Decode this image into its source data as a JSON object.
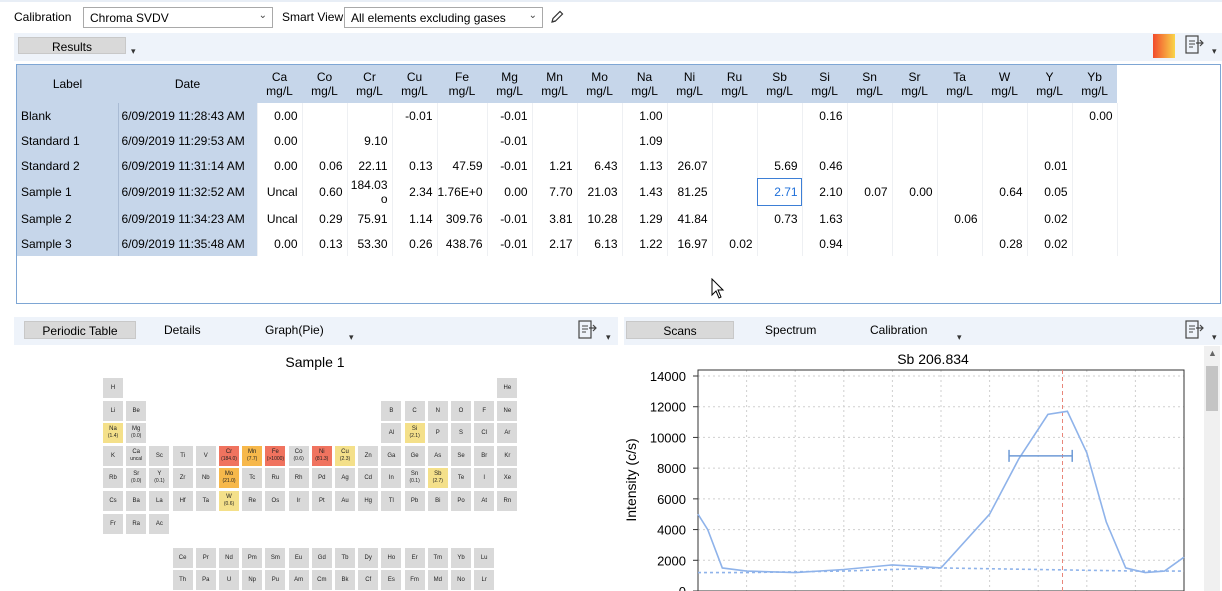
{
  "toolbar": {
    "calibration_label": "Calibration",
    "calibration_value": "Chroma SVDV",
    "smartview_label": "Smart View",
    "smartview_value": "All elements excluding gases"
  },
  "results_tab": "Results",
  "columns": {
    "label": "Label",
    "date": "Date",
    "elements": [
      {
        "el": "Ca",
        "unit": "mg/L"
      },
      {
        "el": "Co",
        "unit": "mg/L"
      },
      {
        "el": "Cr",
        "unit": "mg/L"
      },
      {
        "el": "Cu",
        "unit": "mg/L"
      },
      {
        "el": "Fe",
        "unit": "mg/L"
      },
      {
        "el": "Mg",
        "unit": "mg/L"
      },
      {
        "el": "Mn",
        "unit": "mg/L"
      },
      {
        "el": "Mo",
        "unit": "mg/L"
      },
      {
        "el": "Na",
        "unit": "mg/L"
      },
      {
        "el": "Ni",
        "unit": "mg/L"
      },
      {
        "el": "Ru",
        "unit": "mg/L"
      },
      {
        "el": "Sb",
        "unit": "mg/L"
      },
      {
        "el": "Si",
        "unit": "mg/L"
      },
      {
        "el": "Sn",
        "unit": "mg/L"
      },
      {
        "el": "Sr",
        "unit": "mg/L"
      },
      {
        "el": "Ta",
        "unit": "mg/L"
      },
      {
        "el": "W",
        "unit": "mg/L"
      },
      {
        "el": "Y",
        "unit": "mg/L"
      },
      {
        "el": "Yb",
        "unit": "mg/L"
      }
    ]
  },
  "rows": [
    {
      "label": "Blank",
      "date": "6/09/2019 11:28:43 AM",
      "values": [
        "0.00",
        "",
        "",
        "-0.01",
        "",
        "-0.01",
        "",
        "",
        "1.00",
        "",
        "",
        "",
        "0.16",
        "",
        "",
        "",
        "",
        "",
        "0.00"
      ]
    },
    {
      "label": "Standard 1",
      "date": "6/09/2019 11:29:53 AM",
      "values": [
        "0.00",
        "",
        "9.10",
        "",
        "",
        "-0.01",
        "",
        "",
        "1.09",
        "",
        "",
        "",
        "",
        "",
        "",
        "",
        "",
        "",
        ""
      ]
    },
    {
      "label": "Standard 2",
      "date": "6/09/2019 11:31:14 AM",
      "values": [
        "0.00",
        "0.06",
        "22.11",
        "0.13",
        "47.59",
        "-0.01",
        "1.21",
        "6.43",
        "1.13",
        "26.07",
        "",
        "5.69",
        "0.46",
        "",
        "",
        "",
        "",
        "0.01",
        ""
      ]
    },
    {
      "label": "Sample 1",
      "date": "6/09/2019 11:32:52 AM",
      "values": [
        "Uncal",
        "0.60",
        "184.03 o",
        "2.34",
        "1.76E+0",
        "0.00",
        "7.70",
        "21.03",
        "1.43",
        "81.25",
        "",
        "2.71",
        "2.10",
        "0.07",
        "0.00",
        "",
        "0.64",
        "0.05",
        ""
      ]
    },
    {
      "label": "Sample 2",
      "date": "6/09/2019 11:34:23 AM",
      "values": [
        "Uncal",
        "0.29",
        "75.91",
        "1.14",
        "309.76",
        "-0.01",
        "3.81",
        "10.28",
        "1.29",
        "41.84",
        "",
        "0.73",
        "1.63",
        "",
        "",
        "0.06",
        "",
        "0.02",
        ""
      ]
    },
    {
      "label": "Sample 3",
      "date": "6/09/2019 11:35:48 AM",
      "values": [
        "0.00",
        "0.13",
        "53.30",
        "0.26",
        "438.76",
        "-0.01",
        "2.17",
        "6.13",
        "1.22",
        "16.97",
        "0.02",
        "",
        "0.94",
        "",
        "",
        "",
        "0.28",
        "0.02",
        ""
      ]
    }
  ],
  "selected_cell": {
    "row": 3,
    "col": 11
  },
  "left_tabs": [
    "Periodic Table",
    "Details",
    "Graph(Pie)"
  ],
  "right_tabs": [
    "Scans",
    "Spectrum",
    "Calibration"
  ],
  "periodic_title": "Sample 1",
  "periodic_cells": [
    {
      "sym": "H",
      "r": 0,
      "c": 0
    },
    {
      "sym": "He",
      "r": 0,
      "c": 17
    },
    {
      "sym": "Li",
      "r": 1,
      "c": 0
    },
    {
      "sym": "Be",
      "r": 1,
      "c": 1
    },
    {
      "sym": "B",
      "r": 1,
      "c": 12
    },
    {
      "sym": "C",
      "r": 1,
      "c": 13
    },
    {
      "sym": "N",
      "r": 1,
      "c": 14
    },
    {
      "sym": "O",
      "r": 1,
      "c": 15
    },
    {
      "sym": "F",
      "r": 1,
      "c": 16
    },
    {
      "sym": "Ne",
      "r": 1,
      "c": 17
    },
    {
      "sym": "Na",
      "r": 2,
      "c": 0,
      "val": "(1.4)",
      "color": "#f4e08a"
    },
    {
      "sym": "Mg",
      "r": 2,
      "c": 1,
      "val": "(0.0)"
    },
    {
      "sym": "Al",
      "r": 2,
      "c": 12
    },
    {
      "sym": "Si",
      "r": 2,
      "c": 13,
      "val": "(2.1)",
      "color": "#f4e08a"
    },
    {
      "sym": "P",
      "r": 2,
      "c": 14
    },
    {
      "sym": "S",
      "r": 2,
      "c": 15
    },
    {
      "sym": "Cl",
      "r": 2,
      "c": 16
    },
    {
      "sym": "Ar",
      "r": 2,
      "c": 17
    },
    {
      "sym": "K",
      "r": 3,
      "c": 0
    },
    {
      "sym": "Ca",
      "r": 3,
      "c": 1,
      "val": "uncal"
    },
    {
      "sym": "Sc",
      "r": 3,
      "c": 2
    },
    {
      "sym": "Ti",
      "r": 3,
      "c": 3
    },
    {
      "sym": "V",
      "r": 3,
      "c": 4
    },
    {
      "sym": "Cr",
      "r": 3,
      "c": 5,
      "val": "(184.0)",
      "color": "#f0735f"
    },
    {
      "sym": "Mn",
      "r": 3,
      "c": 6,
      "val": "(7.7)",
      "color": "#f7b84b"
    },
    {
      "sym": "Fe",
      "r": 3,
      "c": 7,
      "val": "(>1000)",
      "color": "#f0735f"
    },
    {
      "sym": "Co",
      "r": 3,
      "c": 8,
      "val": "(0.6)"
    },
    {
      "sym": "Ni",
      "r": 3,
      "c": 9,
      "val": "(81.3)",
      "color": "#f0735f"
    },
    {
      "sym": "Cu",
      "r": 3,
      "c": 10,
      "val": "(2.3)",
      "color": "#f4e08a"
    },
    {
      "sym": "Zn",
      "r": 3,
      "c": 11
    },
    {
      "sym": "Ga",
      "r": 3,
      "c": 12
    },
    {
      "sym": "Ge",
      "r": 3,
      "c": 13
    },
    {
      "sym": "As",
      "r": 3,
      "c": 14
    },
    {
      "sym": "Se",
      "r": 3,
      "c": 15
    },
    {
      "sym": "Br",
      "r": 3,
      "c": 16
    },
    {
      "sym": "Kr",
      "r": 3,
      "c": 17
    },
    {
      "sym": "Rb",
      "r": 4,
      "c": 0
    },
    {
      "sym": "Sr",
      "r": 4,
      "c": 1,
      "val": "(0.0)"
    },
    {
      "sym": "Y",
      "r": 4,
      "c": 2,
      "val": "(0.1)"
    },
    {
      "sym": "Zr",
      "r": 4,
      "c": 3
    },
    {
      "sym": "Nb",
      "r": 4,
      "c": 4
    },
    {
      "sym": "Mo",
      "r": 4,
      "c": 5,
      "val": "(21.0)",
      "color": "#f7b84b"
    },
    {
      "sym": "Tc",
      "r": 4,
      "c": 6
    },
    {
      "sym": "Ru",
      "r": 4,
      "c": 7
    },
    {
      "sym": "Rh",
      "r": 4,
      "c": 8
    },
    {
      "sym": "Pd",
      "r": 4,
      "c": 9
    },
    {
      "sym": "Ag",
      "r": 4,
      "c": 10
    },
    {
      "sym": "Cd",
      "r": 4,
      "c": 11
    },
    {
      "sym": "In",
      "r": 4,
      "c": 12
    },
    {
      "sym": "Sn",
      "r": 4,
      "c": 13,
      "val": "(0.1)"
    },
    {
      "sym": "Sb",
      "r": 4,
      "c": 14,
      "val": "(2.7)",
      "color": "#f4e08a"
    },
    {
      "sym": "Te",
      "r": 4,
      "c": 15
    },
    {
      "sym": "I",
      "r": 4,
      "c": 16
    },
    {
      "sym": "Xe",
      "r": 4,
      "c": 17
    },
    {
      "sym": "Cs",
      "r": 5,
      "c": 0
    },
    {
      "sym": "Ba",
      "r": 5,
      "c": 1
    },
    {
      "sym": "La",
      "r": 5,
      "c": 2
    },
    {
      "sym": "Hf",
      "r": 5,
      "c": 3
    },
    {
      "sym": "Ta",
      "r": 5,
      "c": 4
    },
    {
      "sym": "W",
      "r": 5,
      "c": 5,
      "val": "(0.6)",
      "color": "#f4e08a"
    },
    {
      "sym": "Re",
      "r": 5,
      "c": 6
    },
    {
      "sym": "Os",
      "r": 5,
      "c": 7
    },
    {
      "sym": "Ir",
      "r": 5,
      "c": 8
    },
    {
      "sym": "Pt",
      "r": 5,
      "c": 9
    },
    {
      "sym": "Au",
      "r": 5,
      "c": 10
    },
    {
      "sym": "Hg",
      "r": 5,
      "c": 11
    },
    {
      "sym": "Tl",
      "r": 5,
      "c": 12
    },
    {
      "sym": "Pb",
      "r": 5,
      "c": 13
    },
    {
      "sym": "Bi",
      "r": 5,
      "c": 14
    },
    {
      "sym": "Po",
      "r": 5,
      "c": 15
    },
    {
      "sym": "At",
      "r": 5,
      "c": 16
    },
    {
      "sym": "Rn",
      "r": 5,
      "c": 17
    },
    {
      "sym": "Fr",
      "r": 6,
      "c": 0
    },
    {
      "sym": "Ra",
      "r": 6,
      "c": 1
    },
    {
      "sym": "Ac",
      "r": 6,
      "c": 2
    },
    {
      "sym": "Ce",
      "r": 7.5,
      "c": 3
    },
    {
      "sym": "Pr",
      "r": 7.5,
      "c": 4
    },
    {
      "sym": "Nd",
      "r": 7.5,
      "c": 5
    },
    {
      "sym": "Pm",
      "r": 7.5,
      "c": 6
    },
    {
      "sym": "Sm",
      "r": 7.5,
      "c": 7
    },
    {
      "sym": "Eu",
      "r": 7.5,
      "c": 8
    },
    {
      "sym": "Gd",
      "r": 7.5,
      "c": 9
    },
    {
      "sym": "Tb",
      "r": 7.5,
      "c": 10
    },
    {
      "sym": "Dy",
      "r": 7.5,
      "c": 11
    },
    {
      "sym": "Ho",
      "r": 7.5,
      "c": 12
    },
    {
      "sym": "Er",
      "r": 7.5,
      "c": 13
    },
    {
      "sym": "Tm",
      "r": 7.5,
      "c": 14
    },
    {
      "sym": "Yb",
      "r": 7.5,
      "c": 15
    },
    {
      "sym": "Lu",
      "r": 7.5,
      "c": 16
    },
    {
      "sym": "Th",
      "r": 8.5,
      "c": 3
    },
    {
      "sym": "Pa",
      "r": 8.5,
      "c": 4
    },
    {
      "sym": "U",
      "r": 8.5,
      "c": 5
    },
    {
      "sym": "Np",
      "r": 8.5,
      "c": 6
    },
    {
      "sym": "Pu",
      "r": 8.5,
      "c": 7
    },
    {
      "sym": "Am",
      "r": 8.5,
      "c": 8
    },
    {
      "sym": "Cm",
      "r": 8.5,
      "c": 9
    },
    {
      "sym": "Bk",
      "r": 8.5,
      "c": 10
    },
    {
      "sym": "Cf",
      "r": 8.5,
      "c": 11
    },
    {
      "sym": "Es",
      "r": 8.5,
      "c": 12
    },
    {
      "sym": "Fm",
      "r": 8.5,
      "c": 13
    },
    {
      "sym": "Md",
      "r": 8.5,
      "c": 14
    },
    {
      "sym": "No",
      "r": 8.5,
      "c": 15
    },
    {
      "sym": "Lr",
      "r": 8.5,
      "c": 16
    }
  ],
  "chart_data": {
    "type": "line",
    "title": "Sb 206.834",
    "ylabel": "Intensity (c/s)",
    "xlabel": "",
    "ylim": [
      0,
      14000
    ],
    "yticks": [
      0,
      2000,
      4000,
      6000,
      8000,
      10000,
      12000,
      14000
    ],
    "xlim": [
      0,
      1
    ],
    "grid": true,
    "series": [
      {
        "style": "solid",
        "x": [
          0,
          0.02,
          0.05,
          0.1,
          0.2,
          0.3,
          0.4,
          0.5,
          0.6,
          0.66,
          0.72,
          0.76,
          0.8,
          0.84,
          0.88,
          0.92,
          0.96,
          1.0
        ],
        "y": [
          5000,
          4000,
          1500,
          1300,
          1200,
          1400,
          1700,
          1500,
          5000,
          8600,
          11500,
          11700,
          9000,
          4500,
          1500,
          1200,
          1300,
          2200
        ]
      },
      {
        "style": "dashed",
        "x": [
          0,
          0.1,
          0.3,
          0.5,
          0.7,
          0.9,
          1.0
        ],
        "y": [
          1200,
          1200,
          1300,
          1500,
          1400,
          1300,
          1300
        ]
      }
    ],
    "marker_x": 0.75,
    "errorbar": {
      "x0": 0.64,
      "x1": 0.77,
      "y": 8800
    }
  }
}
